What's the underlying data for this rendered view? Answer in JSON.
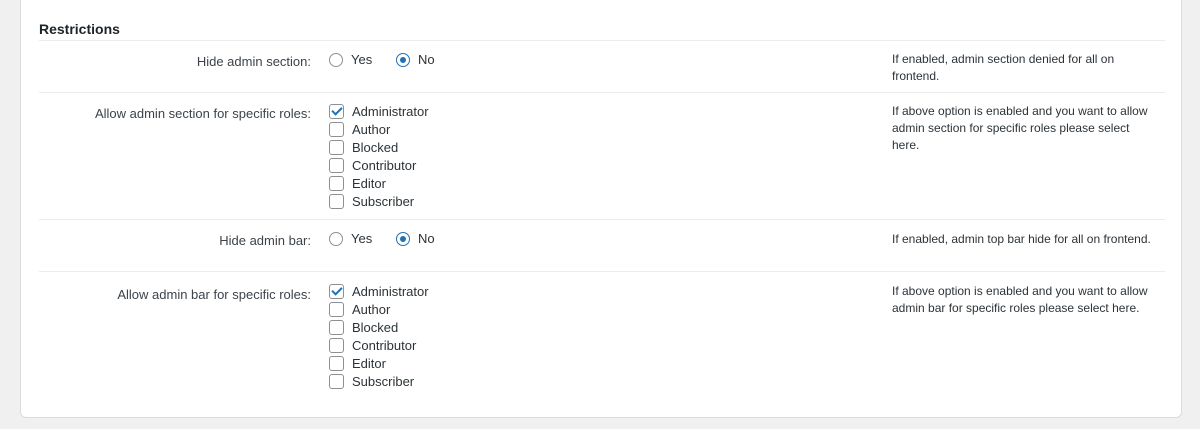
{
  "section": {
    "title": "Restrictions"
  },
  "hide_admin_section": {
    "label": "Hide admin section:",
    "options": [
      "Yes",
      "No"
    ],
    "selected": "No",
    "description": "If enabled, admin section denied for all on frontend."
  },
  "allow_admin_section_roles": {
    "label": "Allow admin section for specific roles:",
    "roles": [
      "Administrator",
      "Author",
      "Blocked",
      "Contributor",
      "Editor",
      "Subscriber"
    ],
    "checked": [
      "Administrator"
    ],
    "description": "If above option is enabled and you want to allow admin section for specific roles please select here."
  },
  "hide_admin_bar": {
    "label": "Hide admin bar:",
    "options": [
      "Yes",
      "No"
    ],
    "selected": "No",
    "description": "If enabled, admin top bar hide for all on frontend."
  },
  "allow_admin_bar_roles": {
    "label": "Allow admin bar for specific roles:",
    "roles": [
      "Administrator",
      "Author",
      "Blocked",
      "Contributor",
      "Editor",
      "Subscriber"
    ],
    "checked": [
      "Administrator"
    ],
    "description": "If above option is enabled and you want to allow admin bar for specific roles please select here."
  },
  "colors": {
    "accent": "#2271b1",
    "background": "#f0f0f1",
    "card": "#ffffff",
    "border": "#dcdcde"
  }
}
